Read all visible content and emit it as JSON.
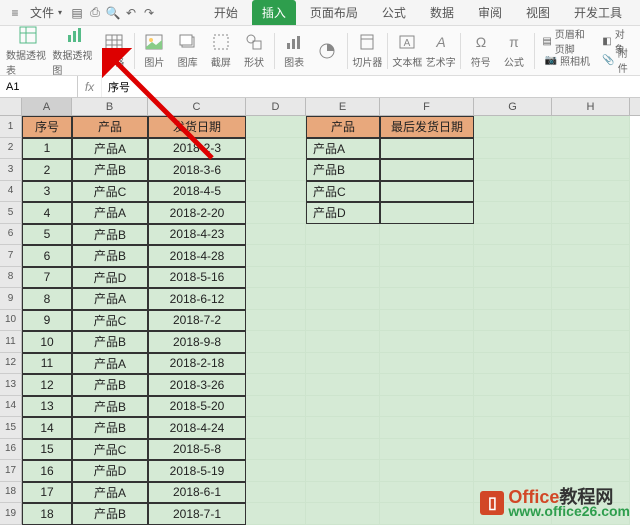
{
  "menubar": {
    "file": "文件",
    "tabs": [
      "开始",
      "插入",
      "页面布局",
      "公式",
      "数据",
      "审阅",
      "视图",
      "开发工具"
    ],
    "active_tab_index": 1
  },
  "ribbon": {
    "pivot_table": "数据透视表",
    "pivot_chart": "数据透视图",
    "table": "表格",
    "picture": "图片",
    "gallery": "图库",
    "screenshot": "截屏",
    "shapes": "形状",
    "chart": "图表",
    "slicer": "切片器",
    "textbox": "文本框",
    "wordart": "艺术字",
    "symbol": "符号",
    "equation": "公式",
    "header_footer": "页眉和页脚",
    "camera": "照相机",
    "object": "对象",
    "attachment": "附件"
  },
  "formula_bar": {
    "cell_ref": "A1",
    "value": "序号"
  },
  "columns": [
    "A",
    "B",
    "C",
    "D",
    "E",
    "F",
    "G",
    "H"
  ],
  "table1": {
    "headers": [
      "序号",
      "产品",
      "发货日期"
    ],
    "rows": [
      [
        "1",
        "产品A",
        "2018-2-3"
      ],
      [
        "2",
        "产品B",
        "2018-3-6"
      ],
      [
        "3",
        "产品C",
        "2018-4-5"
      ],
      [
        "4",
        "产品A",
        "2018-2-20"
      ],
      [
        "5",
        "产品B",
        "2018-4-23"
      ],
      [
        "6",
        "产品B",
        "2018-4-28"
      ],
      [
        "7",
        "产品D",
        "2018-5-16"
      ],
      [
        "8",
        "产品A",
        "2018-6-12"
      ],
      [
        "9",
        "产品C",
        "2018-7-2"
      ],
      [
        "10",
        "产品B",
        "2018-9-8"
      ],
      [
        "11",
        "产品A",
        "2018-2-18"
      ],
      [
        "12",
        "产品B",
        "2018-3-26"
      ],
      [
        "13",
        "产品B",
        "2018-5-20"
      ],
      [
        "14",
        "产品B",
        "2018-4-24"
      ],
      [
        "15",
        "产品C",
        "2018-5-8"
      ],
      [
        "16",
        "产品D",
        "2018-5-19"
      ],
      [
        "17",
        "产品A",
        "2018-6-1"
      ],
      [
        "18",
        "产品B",
        "2018-7-1"
      ]
    ]
  },
  "table2": {
    "headers": [
      "产品",
      "最后发货日期"
    ],
    "rows": [
      [
        "产品A",
        ""
      ],
      [
        "产品B",
        ""
      ],
      [
        "产品C",
        ""
      ],
      [
        "产品D",
        ""
      ]
    ]
  },
  "watermark": {
    "brand": "Office",
    "suffix": "教程网",
    "url": "www.office26.com"
  }
}
